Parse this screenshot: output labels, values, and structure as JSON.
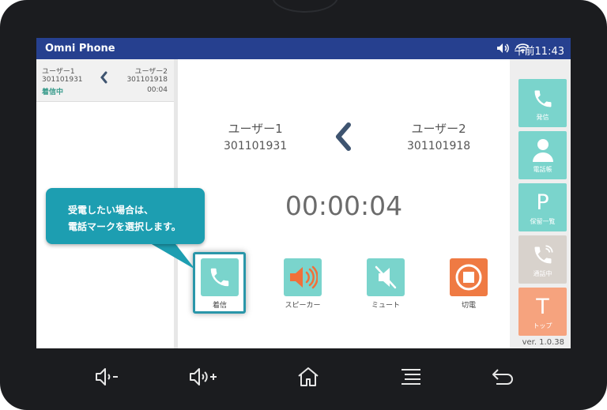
{
  "status_bar": {
    "app_title": "Omni Phone",
    "time": "午前11:43"
  },
  "call_list": {
    "items": [
      {
        "caller_name": "ユーザー1",
        "caller_number": "301101931",
        "status": "着信中",
        "callee_name": "ユーザー2",
        "callee_number": "301101918",
        "duration": "00:04"
      }
    ]
  },
  "call_view": {
    "caller": {
      "name": "ユーザー1",
      "number": "301101931"
    },
    "callee": {
      "name": "ユーザー2",
      "number": "301101918"
    },
    "timer": "00:00:04"
  },
  "controls": {
    "answer": "着信",
    "speaker": "スピーカー",
    "mute": "ミュート",
    "hangup": "切電"
  },
  "side_menu": {
    "dial": "発信",
    "phonebook": "電話帳",
    "hold_list_letter": "P",
    "hold_list": "保留一覧",
    "in_call": "通話中",
    "top_letter": "T",
    "top": "トップ"
  },
  "version": "ver. 1.0.38",
  "tooltip": {
    "line1": "受電したい場合は、",
    "line2": "電話マークを選択します。"
  },
  "colors": {
    "status_bar": "#26408f",
    "teal": "#7ad4cc",
    "speaker": "#7ad4cc",
    "hangup": "#ef7a43",
    "disabled": "#d8d2cc",
    "top": "#f6a37e",
    "bubble": "#1d9eb1"
  },
  "icons": {
    "nav_bar": [
      "volume-down-icon",
      "volume-up-icon",
      "home-icon",
      "menu-icon",
      "back-icon"
    ]
  }
}
